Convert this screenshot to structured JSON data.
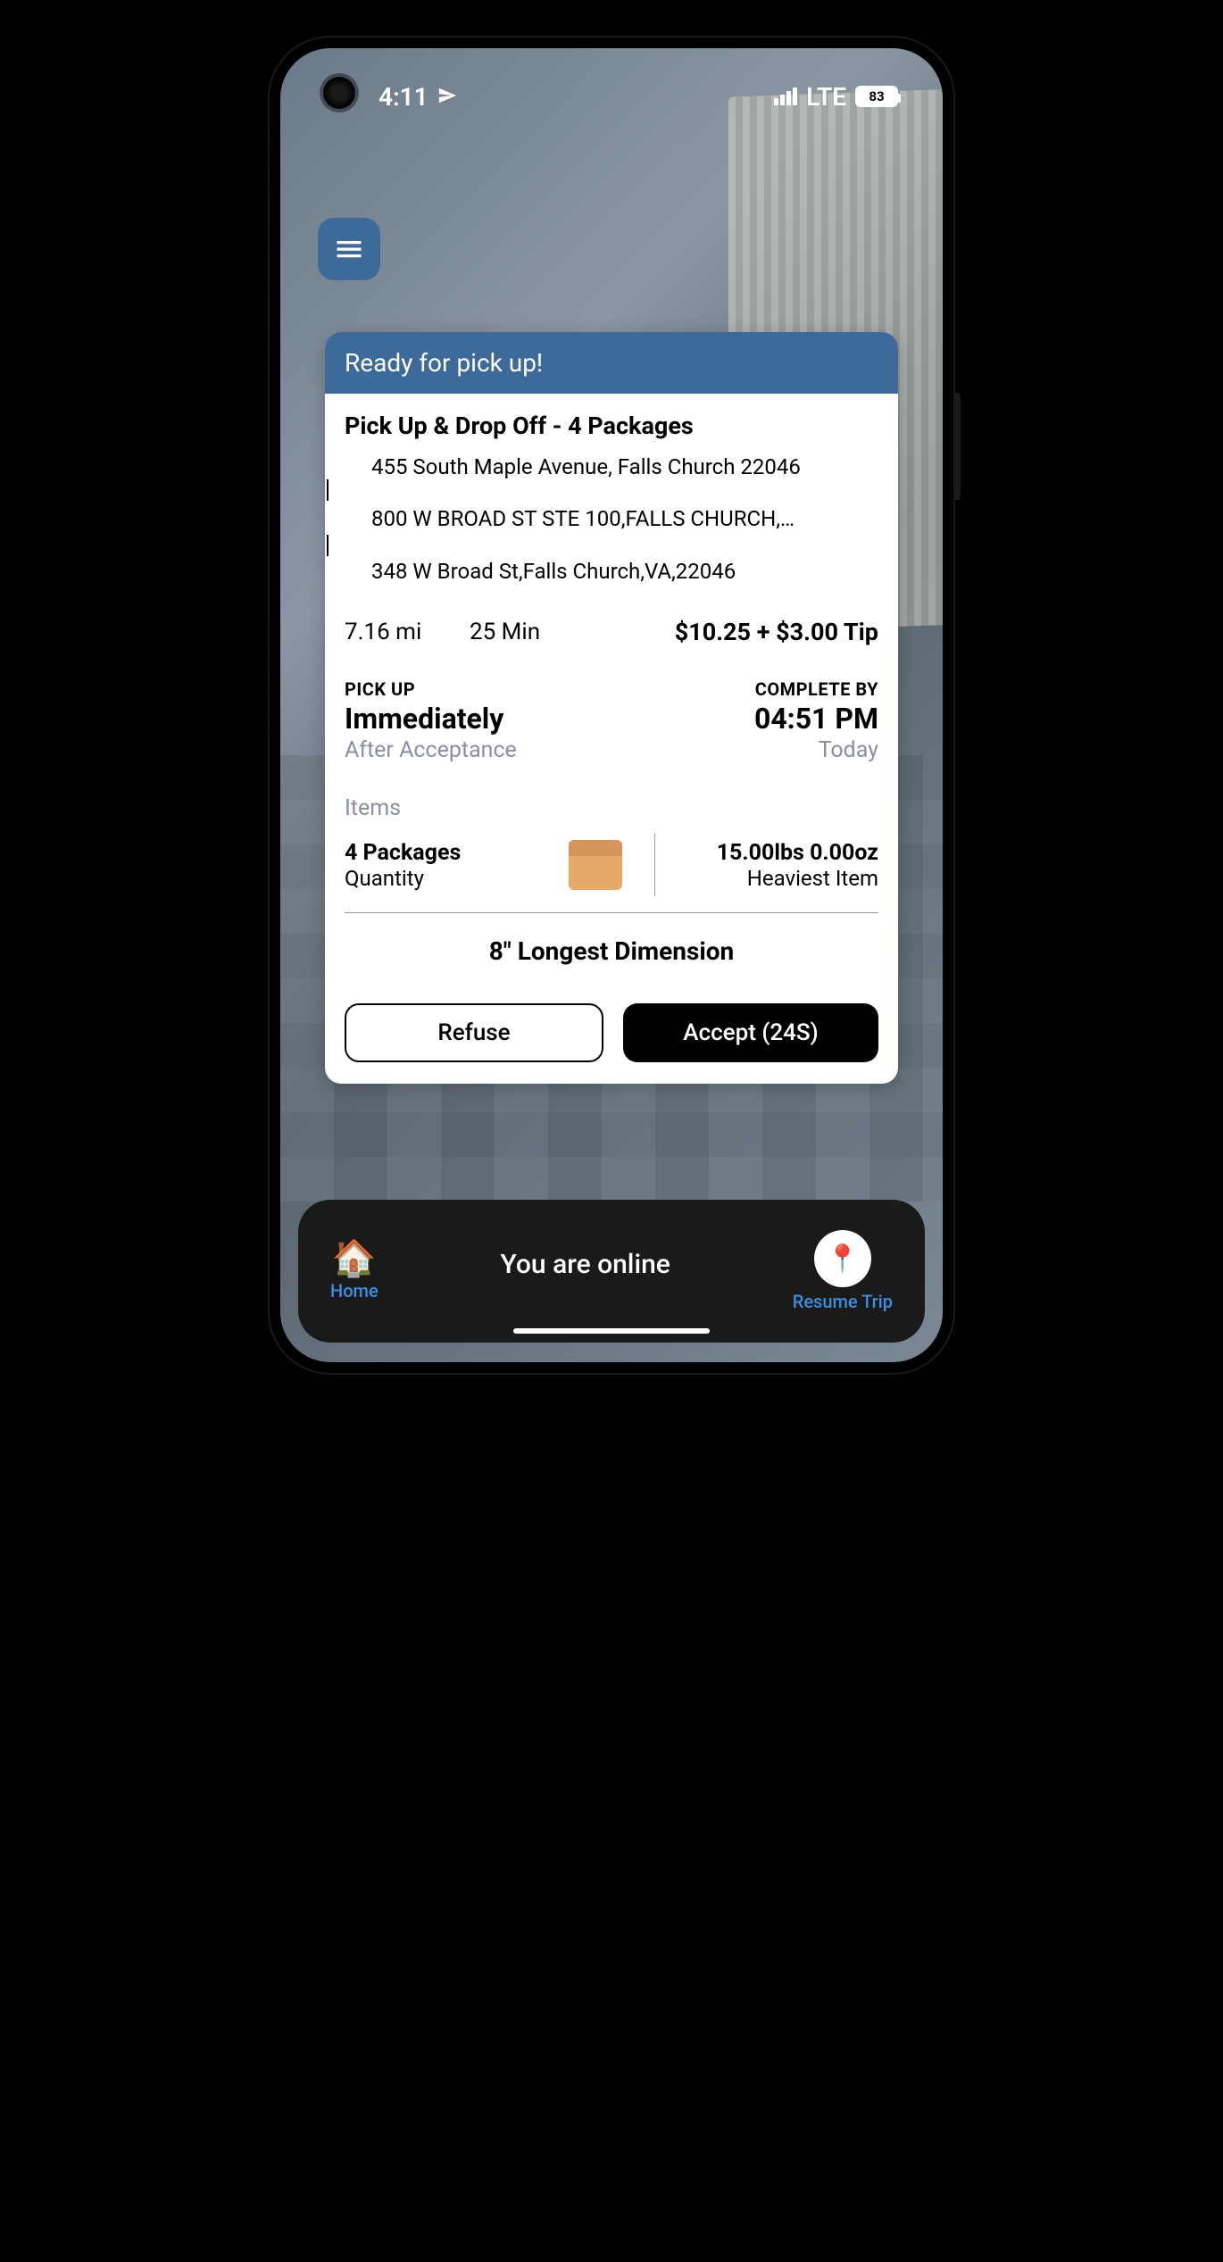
{
  "status": {
    "time": "4:11",
    "network": "LTE",
    "battery": "83"
  },
  "card": {
    "header": "Ready for pick up!",
    "title": "Pick Up & Drop Off - 4 Packages",
    "addresses": [
      "455 South Maple Avenue, Falls Church 22046",
      "800 W BROAD ST STE 100,FALLS CHURCH,…",
      "348 W Broad St,Falls Church,VA,22046"
    ],
    "distance": "7.16 mi",
    "duration": "25 Min",
    "price": "$10.25 + $3.00 Tip",
    "pickup": {
      "label": "PICK UP",
      "value": "Immediately",
      "sub": "After Acceptance"
    },
    "complete": {
      "label": "COMPLETE BY",
      "value": "04:51 PM",
      "sub": "Today"
    },
    "items_label": "Items",
    "packages": "4 Packages",
    "quantity": "Quantity",
    "weight": "15.00lbs 0.00oz",
    "heaviest": "Heaviest Item",
    "longest": "8\" Longest Dimension",
    "refuse": "Refuse",
    "accept": "Accept (24S)"
  },
  "bottom": {
    "home": "Home",
    "center": "You are online",
    "resume": "Resume Trip"
  }
}
